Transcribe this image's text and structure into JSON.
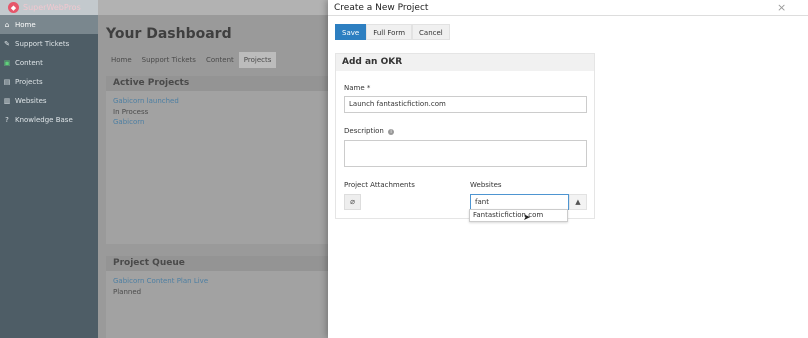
{
  "brand": {
    "name": "SuperWebPros",
    "logo_icon": "shield-icon"
  },
  "sidebar": {
    "items": [
      {
        "label": "Home",
        "icon": "home-icon",
        "glyph": "⌂",
        "active": true
      },
      {
        "label": "Support Tickets",
        "icon": "wrench-icon",
        "glyph": "✎"
      },
      {
        "label": "Content",
        "icon": "content-icon",
        "glyph": "▣",
        "green": true
      },
      {
        "label": "Projects",
        "icon": "projects-icon",
        "glyph": "▤"
      },
      {
        "label": "Websites",
        "icon": "websites-icon",
        "glyph": "▥"
      },
      {
        "label": "Knowledge Base",
        "icon": "question-icon",
        "glyph": "?"
      }
    ]
  },
  "dashboard": {
    "title": "Your Dashboard",
    "tabs": [
      "Home",
      "Support Tickets",
      "Content",
      "Projects"
    ],
    "active_projects": {
      "heading": "Active Projects",
      "item_title": "Gabicorn launched",
      "item_status": "In Process",
      "item_client": "Gabicorn"
    },
    "project_queue": {
      "heading": "Project Queue",
      "item_title": "Gabicorn Content Plan Live",
      "item_status": "Planned"
    }
  },
  "modal": {
    "title": "Create a New Project",
    "close_glyph": "×",
    "buttons": {
      "save": "Save",
      "full_form": "Full Form",
      "cancel": "Cancel"
    },
    "okr": {
      "heading": "Add an OKR",
      "name_label": "Name *",
      "name_value": "Launch fantasticfiction.com",
      "description_label": "Description",
      "description_info_glyph": "i",
      "attachments_label": "Project Attachments",
      "attach_glyph": "⌀",
      "websites_label": "Websites",
      "websites_value": "fant",
      "caret_glyph": "▲",
      "suggestion": "Fantasticfiction.com"
    }
  }
}
